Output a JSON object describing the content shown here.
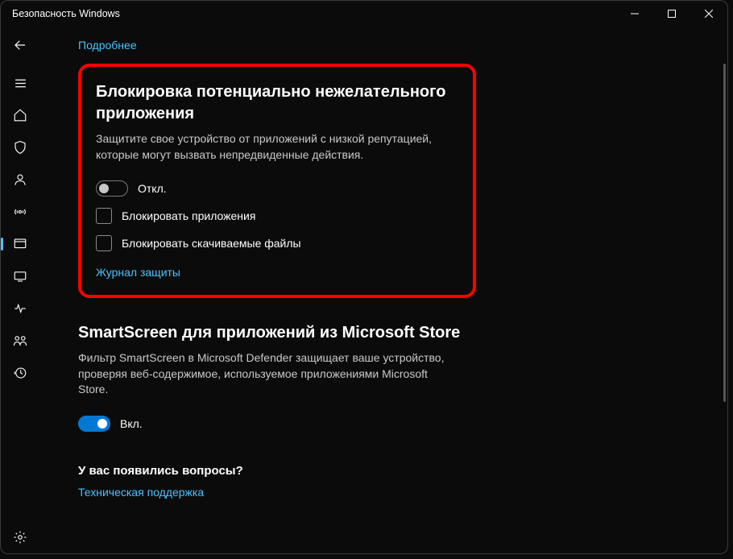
{
  "window": {
    "title": "Безопасность Windows"
  },
  "top": {
    "more_info": "Подробнее"
  },
  "section1": {
    "title": "Блокировка потенциально нежелательного приложения",
    "desc": "Защитите свое устройство от приложений с низкой репутацией, которые могут вызвать непредвиденные действия.",
    "toggle_label": "Откл.",
    "check1": "Блокировать приложения",
    "check2": "Блокировать скачиваемые файлы",
    "history_link": "Журнал защиты"
  },
  "section2": {
    "title": "SmartScreen для приложений из Microsoft Store",
    "desc": "Фильтр SmartScreen в Microsoft Defender защищает ваше устройство, проверяя веб-содержимое, используемое приложениями Microsoft Store.",
    "toggle_label": "Вкл."
  },
  "questions": {
    "title": "У вас появились вопросы?",
    "support_link": "Техническая поддержка"
  }
}
